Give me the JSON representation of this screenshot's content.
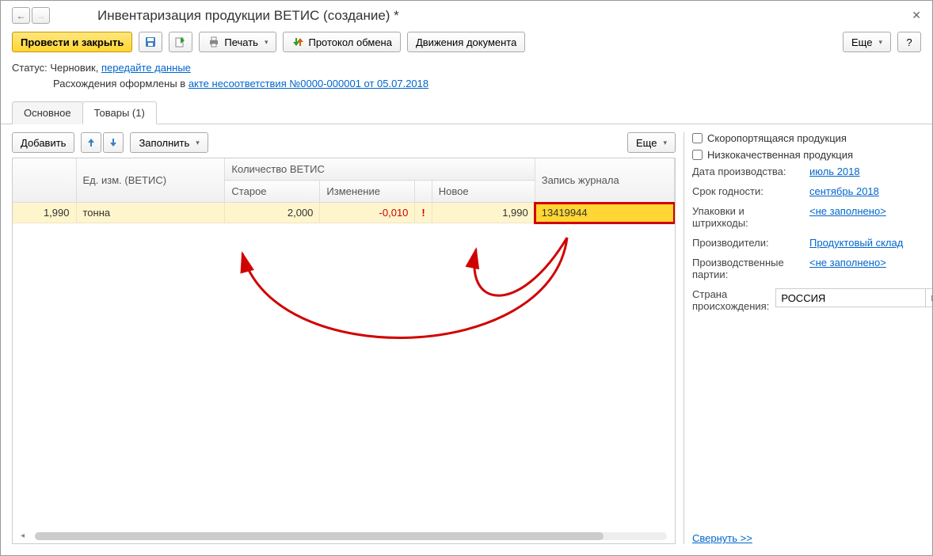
{
  "title": "Инвентаризация продукции ВЕТИС (создание) *",
  "toolbar": {
    "post_close": "Провести и закрыть",
    "print": "Печать",
    "protocol": "Протокол обмена",
    "movements": "Движения документа",
    "more": "Еще"
  },
  "status": {
    "label": "Статус:",
    "draft": "Черновик,",
    "transfer_link": "передайте данные",
    "diff_prefix": "Расхождения оформлены в ",
    "diff_link": "акте несоответствия №0000-000001 от 05.07.2018"
  },
  "tabs": {
    "main": "Основное",
    "goods": "Товары (1)"
  },
  "table_toolbar": {
    "add": "Добавить",
    "fill": "Заполнить",
    "more": "Еще"
  },
  "columns": {
    "unit": "Ед. изм. (ВЕТИС)",
    "qty_group": "Количество ВЕТИС",
    "old": "Старое",
    "change": "Изменение",
    "new": "Новое",
    "journal": "Запись журнала"
  },
  "row": {
    "qty": "1,990",
    "unit": "тонна",
    "old": "2,000",
    "change": "-0,010",
    "new": "1,990",
    "journal": "13419944"
  },
  "side": {
    "perishable": "Скоропортящаяся продукция",
    "low_quality": "Низкокачественная продукция",
    "prod_date_label": "Дата производства:",
    "prod_date_value": "июль 2018",
    "expiry_label": "Срок годности:",
    "expiry_value": "сентябрь 2018",
    "pack_label": "Упаковки и штрихкоды:",
    "empty": "<не заполнено>",
    "producers_label": "Производители:",
    "producers_value": "Продуктовый склад",
    "batches_label": "Производственные партии:",
    "country_label": "Страна происхождения:",
    "country_value": "РОССИЯ",
    "collapse": "Свернуть >>"
  }
}
